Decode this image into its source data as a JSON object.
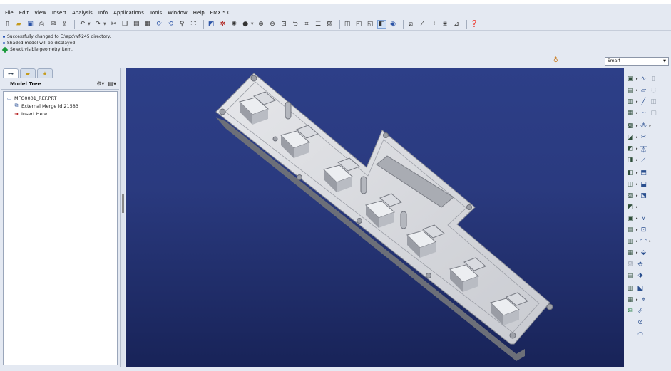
{
  "menu": [
    "File",
    "Edit",
    "View",
    "Insert",
    "Analysis",
    "Info",
    "Applications",
    "Tools",
    "Window",
    "Help",
    "EMX 5.0"
  ],
  "toolbar_icons": [
    "new-icon",
    "open-icon",
    "save-icon",
    "print-icon",
    "email-icon",
    "send-icon",
    "undo-icon",
    "redo-icon",
    "cut-icon",
    "copy-icon",
    "paste-icon",
    "paste-special-icon",
    "regenerate-icon",
    "regenerate-manager-icon",
    "find-icon",
    "select-box-icon",
    "repaint-icon",
    "spin-center-icon",
    "orient-icon",
    "appearance-icon",
    "zoom-in-icon",
    "zoom-out-icon",
    "refit-icon",
    "reorient-icon",
    "saved-views-icon",
    "layers-icon",
    "view-manager-icon",
    "wireframe-icon",
    "hidden-line-icon",
    "no-hidden-icon",
    "shading-icon",
    "enhanced-realism-icon",
    "datum-planes-icon",
    "datum-axes-icon",
    "datum-points-icon",
    "csys-icon",
    "annotations-icon",
    "whats-this-icon"
  ],
  "messages": [
    {
      "type": "info",
      "text": "Successfully changed to E:\\apc\\wf-245 directory."
    },
    {
      "type": "info",
      "text": "Shaded model will be displayed"
    },
    {
      "type": "prompt",
      "text": "Select visible geometry item."
    }
  ],
  "filter": {
    "value": "Smart"
  },
  "model_tree": {
    "title": "Model Tree",
    "items": [
      {
        "label": "MFG0001_REF.PRT",
        "icon": "part-icon",
        "indent": 0
      },
      {
        "label": "External Merge id 21583",
        "icon": "merge-icon",
        "indent": 1
      },
      {
        "label": "Insert Here",
        "icon": "insert-here-icon",
        "indent": 1
      }
    ]
  },
  "colors": {
    "viewport_top": "#2d3f88",
    "viewport_bottom": "#182358",
    "model": "#d7d8dc"
  }
}
